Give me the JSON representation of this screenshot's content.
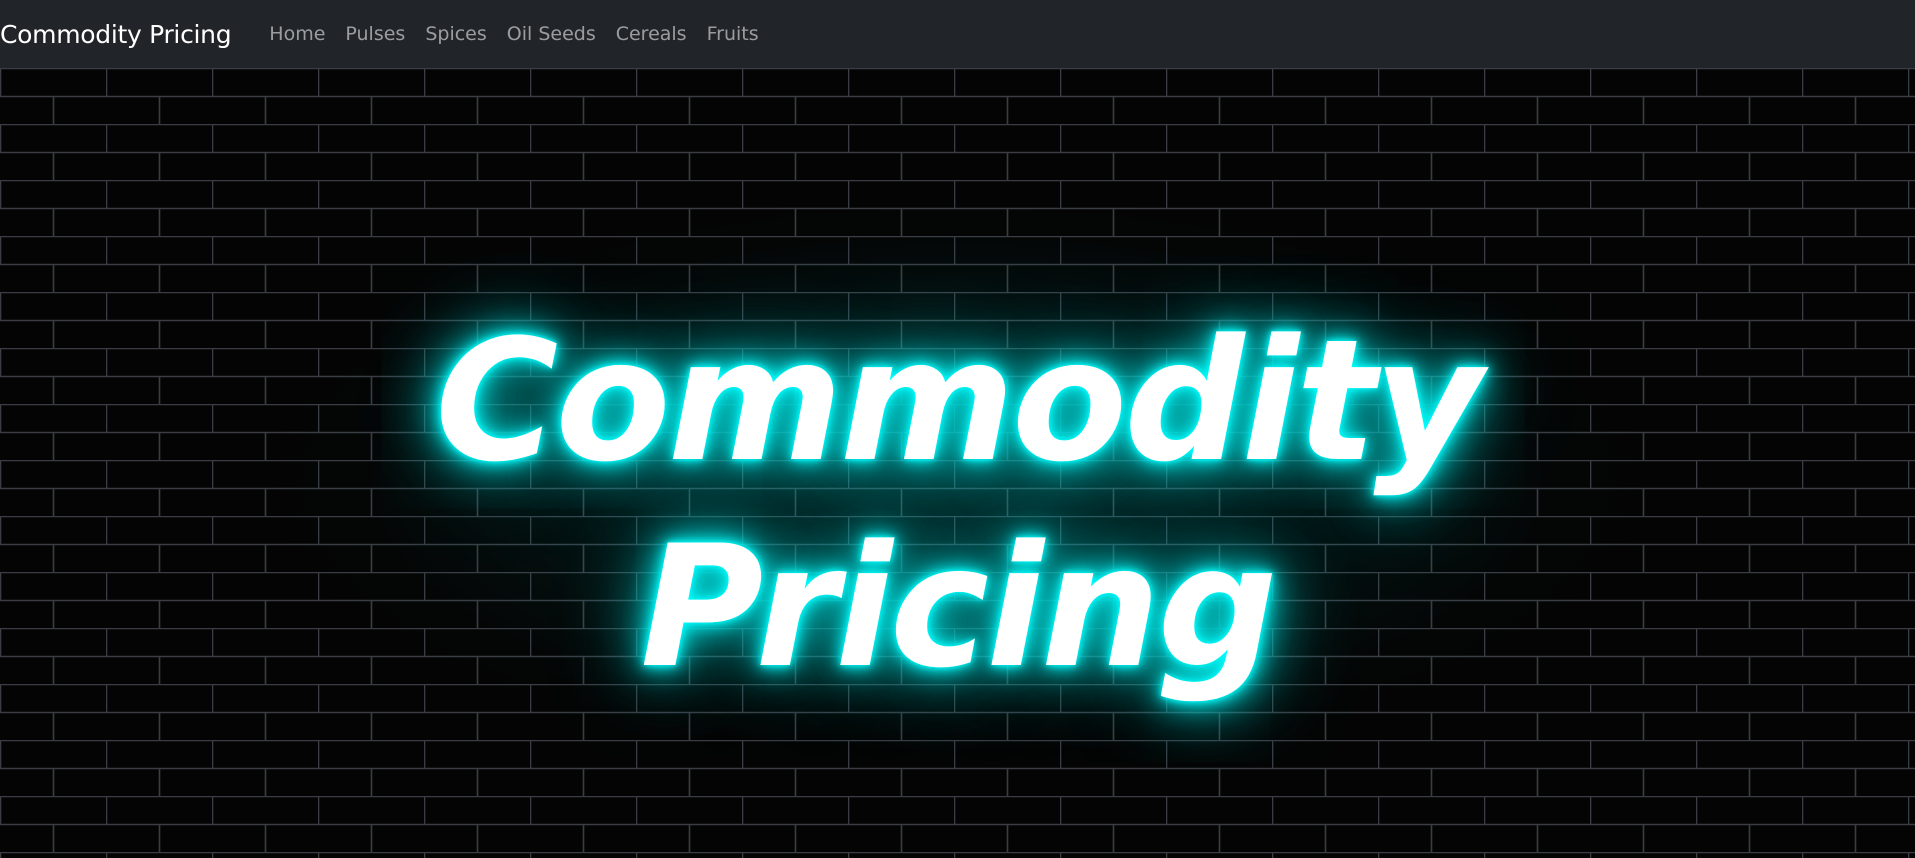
{
  "navbar": {
    "brand": "Commodity Pricing",
    "links": [
      "Home",
      "Pulses",
      "Spices",
      "Oil Seeds",
      "Cereals",
      "Fruits"
    ]
  },
  "hero": {
    "title_line1": "Commodity",
    "title_line2": "Pricing"
  },
  "colors": {
    "navbar_bg": "#212529",
    "glow": "#00ffff",
    "wall_bg": "#040404",
    "mortar": "#3a3d44"
  }
}
